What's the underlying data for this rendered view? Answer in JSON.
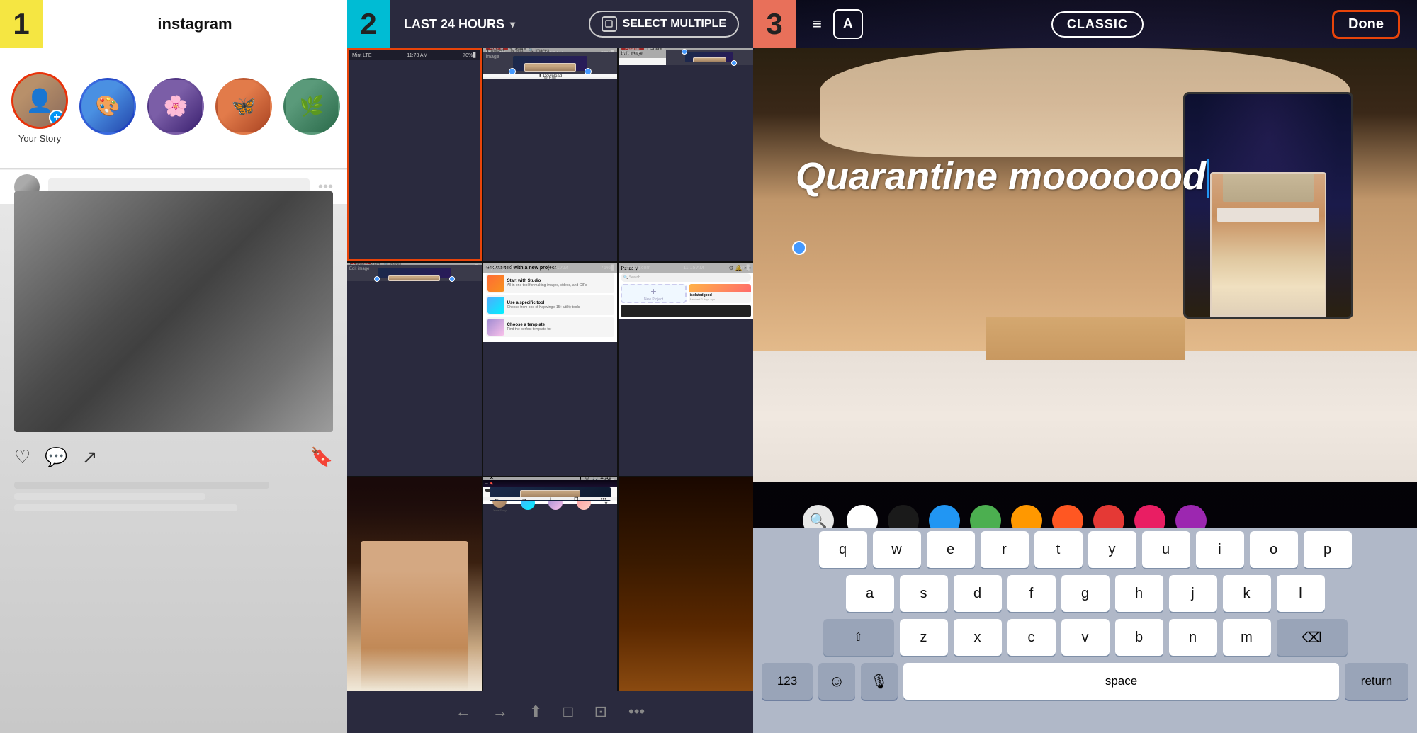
{
  "panel1": {
    "number": "1",
    "title": "instagram",
    "stories": [
      {
        "label": "Your Story",
        "type": "your"
      },
      {
        "label": "",
        "type": "gradient1"
      },
      {
        "label": "",
        "type": "gradient2"
      },
      {
        "label": "",
        "type": "gradient3"
      },
      {
        "label": "",
        "type": "gradient4"
      }
    ]
  },
  "panel2": {
    "number": "2",
    "last24": "LAST 24 HOURS",
    "selectMultiple": "SELECT MULTIPLE",
    "screenshots": [
      {
        "id": "ss1",
        "selected": true
      },
      {
        "id": "ss2",
        "selected": false
      },
      {
        "id": "ss3",
        "selected": false
      },
      {
        "id": "ss4",
        "selected": false
      },
      {
        "id": "ss5",
        "selected": false
      },
      {
        "id": "ss6",
        "selected": false
      },
      {
        "id": "ss7",
        "selected": false
      },
      {
        "id": "ss8",
        "selected": false
      },
      {
        "id": "ss9",
        "selected": false
      }
    ]
  },
  "panel3": {
    "number": "3",
    "classicLabel": "CLASSIC",
    "doneLabel": "Done",
    "storyText": "Quarantine mooooood",
    "colors": [
      {
        "name": "white",
        "hex": "#ffffff"
      },
      {
        "name": "black",
        "hex": "#1a1a1a"
      },
      {
        "name": "blue",
        "hex": "#2196f3"
      },
      {
        "name": "green",
        "hex": "#4caf50"
      },
      {
        "name": "yellow-orange",
        "hex": "#ff9800"
      },
      {
        "name": "orange",
        "hex": "#ff5722"
      },
      {
        "name": "red",
        "hex": "#e53935"
      },
      {
        "name": "pink",
        "hex": "#e91e63"
      },
      {
        "name": "purple",
        "hex": "#9c27b0"
      }
    ],
    "keyboard": {
      "row1": [
        "q",
        "w",
        "e",
        "r",
        "t",
        "y",
        "u",
        "i",
        "o",
        "p"
      ],
      "row2": [
        "a",
        "s",
        "d",
        "f",
        "g",
        "h",
        "j",
        "k",
        "l"
      ],
      "row3": [
        "z",
        "x",
        "c",
        "v",
        "b",
        "n",
        "m"
      ],
      "num": "123",
      "space": "space",
      "return": "return"
    }
  }
}
